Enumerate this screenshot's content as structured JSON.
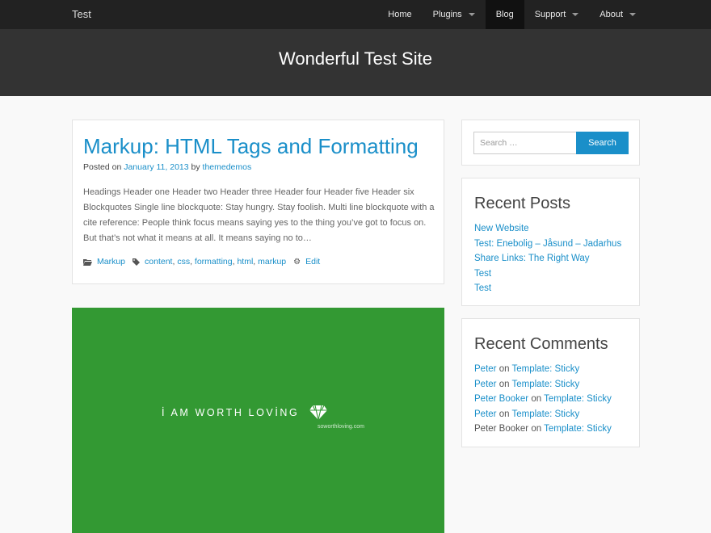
{
  "nav": {
    "brand": "Test",
    "items": [
      {
        "label": "Home"
      },
      {
        "label": "Plugins"
      },
      {
        "label": "Blog"
      },
      {
        "label": "Support"
      },
      {
        "label": "About"
      }
    ],
    "active": "Blog"
  },
  "hero": {
    "title": "Wonderful Test Site"
  },
  "post": {
    "title": "Markup: HTML Tags and Formatting",
    "posted_on": "Posted on",
    "date": "January 11, 2013",
    "by": "by",
    "author": "themedemos",
    "excerpt": "Headings Header one Header two Header three Header four Header five Header six Blockquotes Single line blockquote: Stay hungry. Stay foolish. Multi line blockquote with a cite reference: People think focus means saying yes to the thing you’ve got to focus on. But that’s not what it means at all. It means saying no to…",
    "category": "Markup",
    "tags": [
      "content",
      "css",
      "formatting",
      "html",
      "markup"
    ],
    "edit": "Edit"
  },
  "image_post": {
    "slogan": "İ AM WORTH LOVİNG",
    "url": "soworthloving.com",
    "background": "#339933"
  },
  "search": {
    "placeholder": "Search …",
    "button": "Search"
  },
  "recent_posts": {
    "title": "Recent Posts",
    "items": [
      "New Website",
      "Test: Enebolig – Jåsund – Jadarhus",
      "Share Links: The Right Way",
      "Test",
      "Test"
    ]
  },
  "recent_comments": {
    "title": "Recent Comments",
    "on": "on",
    "items": [
      {
        "author": "Peter",
        "post": "Template: Sticky"
      },
      {
        "author": "Peter",
        "post": "Template: Sticky"
      },
      {
        "author": "Peter Booker",
        "post": "Template: Sticky"
      },
      {
        "author": "Peter",
        "post": "Template: Sticky"
      },
      {
        "author": "Peter Booker",
        "post": "Template: Sticky"
      }
    ]
  },
  "colors": {
    "accent": "#1a8fc9",
    "navbar": "#222222",
    "hero": "#333333"
  }
}
